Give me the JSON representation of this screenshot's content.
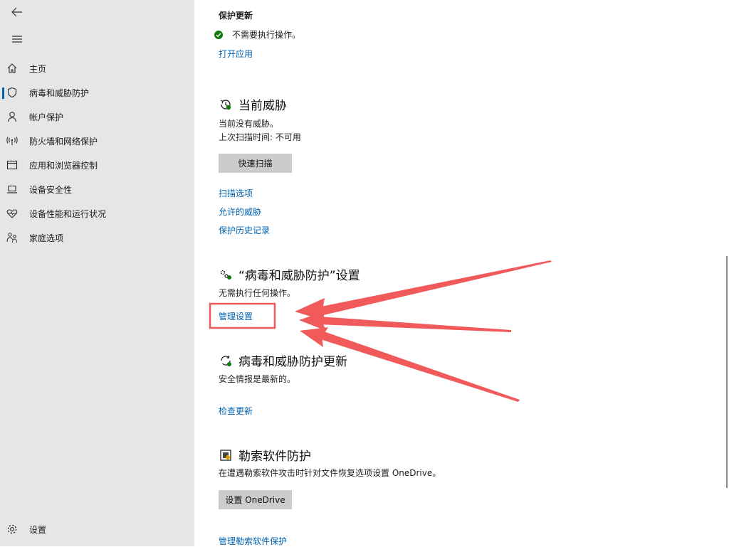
{
  "sidebar": {
    "items": [
      {
        "label": "主页",
        "icon": "home-icon"
      },
      {
        "label": "病毒和威胁防护",
        "icon": "shield-icon",
        "active": true
      },
      {
        "label": "帐户保护",
        "icon": "person-icon"
      },
      {
        "label": "防火墙和网络保护",
        "icon": "wifi-antenna-icon"
      },
      {
        "label": "应用和浏览器控制",
        "icon": "app-window-icon"
      },
      {
        "label": "设备安全性",
        "icon": "laptop-icon"
      },
      {
        "label": "设备性能和运行状况",
        "icon": "heart-pulse-icon"
      },
      {
        "label": "家庭选项",
        "icon": "family-icon"
      }
    ],
    "settings_label": "设置"
  },
  "main": {
    "protection_updates": {
      "title": "保护更新",
      "status": "不需要执行操作。",
      "open_app_link": "打开应用"
    },
    "current_threats": {
      "title": "当前威胁",
      "no_threats": "当前没有威胁。",
      "last_scan": "上次扫描时间: 不可用",
      "quick_scan_button": "快速扫描",
      "links": [
        "扫描选项",
        "允许的威胁",
        "保护历史记录"
      ]
    },
    "settings_section": {
      "title": "“病毒和威胁防护”设置",
      "status": "无需执行任何操作。",
      "manage_link": "管理设置"
    },
    "updates_section": {
      "title": "病毒和威胁防护更新",
      "status": "安全情报是最新的。",
      "check_link": "检查更新"
    },
    "ransomware": {
      "title": "勒索软件防护",
      "desc": "在遭遇勒索软件攻击时针对文件恢复选项设置 OneDrive。",
      "setup_button": "设置 OneDrive",
      "manage_link": "管理勒索软件保护"
    }
  },
  "colors": {
    "sidebar_bg": "#e6e6e6",
    "link": "#0063b1",
    "ok_green": "#107c10",
    "annotation_red": "#f05a5a",
    "button_bg": "#cccccc"
  }
}
